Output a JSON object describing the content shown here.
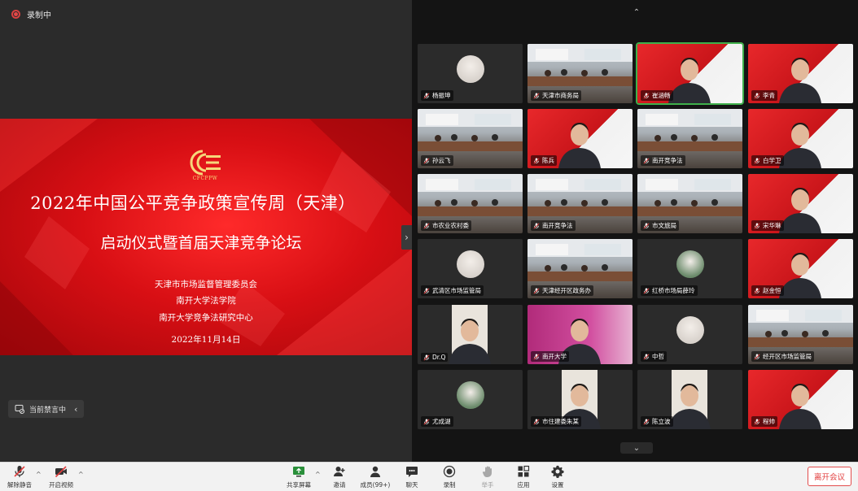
{
  "recording": {
    "label": "录制中"
  },
  "slide": {
    "logo_text": "CFCPPW",
    "title_line1": "2022年中国公平竞争政策宣传周（天津）",
    "title_line2": "启动仪式暨首届天津竞争论坛",
    "organizers": [
      "天津市市场监督管理委员会",
      "南开大学法学院",
      "南开大学竞争法研究中心"
    ],
    "date": "2022年11月14日"
  },
  "mute_status": {
    "label": "当前禁言中"
  },
  "gallery": {
    "participants": [
      {
        "name": "杨振坤",
        "kind": "avatar"
      },
      {
        "name": "天津市商务局",
        "kind": "room"
      },
      {
        "name": "崔涵畅",
        "kind": "person-banner",
        "active": true
      },
      {
        "name": "李青",
        "kind": "person-banner"
      },
      {
        "name": "孙云飞",
        "kind": "room"
      },
      {
        "name": "陈兵",
        "kind": "person-banner"
      },
      {
        "name": "南开竞争法",
        "kind": "room"
      },
      {
        "name": "白学卫",
        "kind": "person-banner"
      },
      {
        "name": "市农业农村委",
        "kind": "room"
      },
      {
        "name": "南开竞争法",
        "kind": "room"
      },
      {
        "name": "市文旅局",
        "kind": "room"
      },
      {
        "name": "宋华琳",
        "kind": "person-banner"
      },
      {
        "name": "武清区市场监管局",
        "kind": "avatar"
      },
      {
        "name": "天津经开区政务办",
        "kind": "room"
      },
      {
        "name": "红桥市场局薛玲",
        "kind": "avatar"
      },
      {
        "name": "赵金恒",
        "kind": "person-banner"
      },
      {
        "name": "Dr.Q",
        "kind": "person-portrait"
      },
      {
        "name": "南开大学",
        "kind": "person-magenta"
      },
      {
        "name": "中哲",
        "kind": "avatar"
      },
      {
        "name": "经开区市场监管局",
        "kind": "room"
      },
      {
        "name": "尤成湖",
        "kind": "avatar"
      },
      {
        "name": "市住建委朱某",
        "kind": "person-portrait"
      },
      {
        "name": "陈立波",
        "kind": "person-portrait"
      },
      {
        "name": "程帅",
        "kind": "person-banner"
      }
    ]
  },
  "toolbar": {
    "mic_label": "解除静音",
    "video_label": "开启视频",
    "share_label": "共享屏幕",
    "invite_label": "邀请",
    "members_label": "成员(99+)",
    "chat_label": "聊天",
    "record_label": "录制",
    "raise_label": "举手",
    "apps_label": "应用",
    "settings_label": "设置",
    "leave_label": "离开会议"
  },
  "colors": {
    "accent_red": "#e23e3e",
    "active_green": "#3fb04b",
    "slide_red": "#d80f14"
  }
}
